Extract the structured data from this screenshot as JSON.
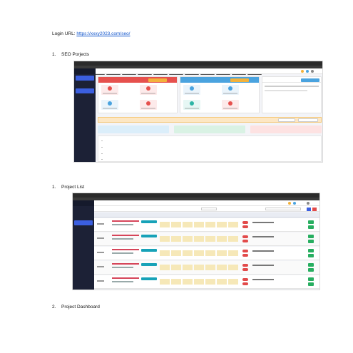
{
  "document": {
    "login": {
      "label": "Login URL: ",
      "url": "https://xxxy2023.com/seo/"
    },
    "sections": [
      {
        "number": "1.",
        "title": "SEO Porjects"
      },
      {
        "number": "1.",
        "title": "Project List"
      },
      {
        "number": "2.",
        "title": "Project Dashboard"
      }
    ]
  },
  "colors": {
    "link": "#1155cc",
    "sidebar": "#1c2136",
    "accent_blue": "#3b5fe0",
    "orange": "#f3b23b",
    "red": "#e6504d",
    "green": "#27ae60"
  }
}
